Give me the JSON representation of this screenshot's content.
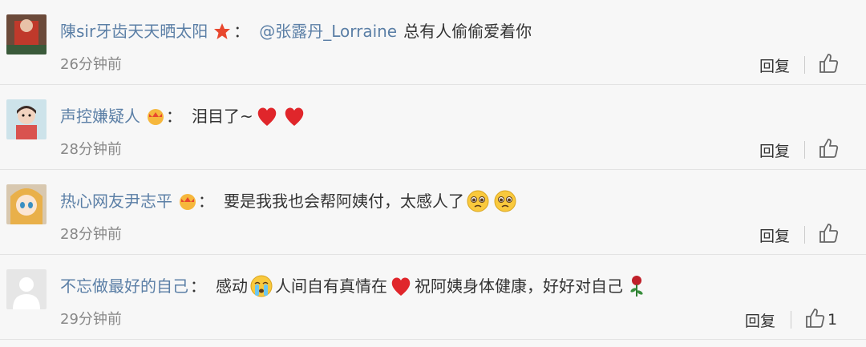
{
  "comments": [
    {
      "username": "陳sir牙齿天天晒太阳",
      "mention": "@张露丹_Lorraine",
      "text": "总有人偷偷爱着你",
      "time": "26分钟前",
      "reply": "回复",
      "likes": ""
    },
    {
      "username": "声控嫌疑人",
      "text": "泪目了~",
      "time": "28分钟前",
      "reply": "回复",
      "likes": ""
    },
    {
      "username": "热心网友尹志平",
      "text": "要是我我也会帮阿姨付，太感人了",
      "time": "28分钟前",
      "reply": "回复",
      "likes": ""
    },
    {
      "username": "不忘做最好的自己",
      "text1": "感动",
      "text2": "人间自有真情在",
      "text3": "祝阿姨身体健康，好好对自己",
      "time": "29分钟前",
      "reply": "回复",
      "likes": "1"
    }
  ],
  "colon": "："
}
